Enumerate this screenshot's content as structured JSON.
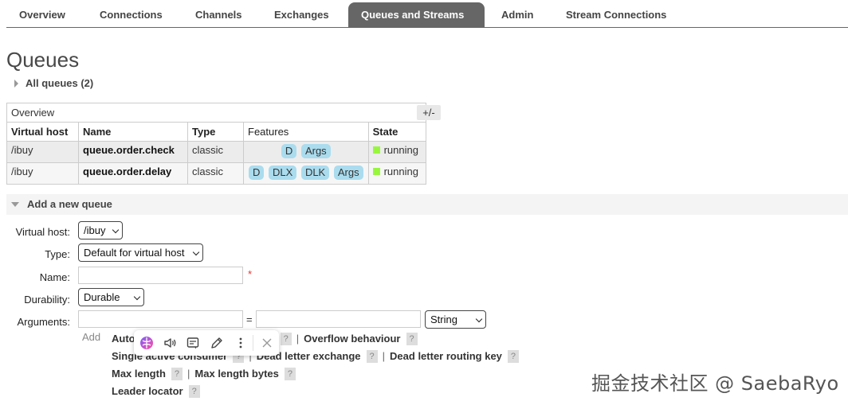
{
  "nav": {
    "tabs": [
      {
        "label": "Overview"
      },
      {
        "label": "Connections"
      },
      {
        "label": "Channels"
      },
      {
        "label": "Exchanges"
      },
      {
        "label": "Queues and Streams",
        "active": true
      },
      {
        "label": "Admin"
      },
      {
        "label": "Stream Connections"
      }
    ]
  },
  "page": {
    "title": "Queues",
    "all_queues": "All queues (2)"
  },
  "table": {
    "group_label": "Overview",
    "toggle_columns": "+/-",
    "headers": {
      "vhost": "Virtual host",
      "name": "Name",
      "type": "Type",
      "features": "Features",
      "state": "State"
    },
    "rows": [
      {
        "vhost": "/ibuy",
        "name": "queue.order.check",
        "type": "classic",
        "features": [
          "D",
          "Args"
        ],
        "state": "running"
      },
      {
        "vhost": "/ibuy",
        "name": "queue.order.delay",
        "type": "classic",
        "features": [
          "D",
          "DLX",
          "DLK",
          "Args"
        ],
        "state": "running"
      }
    ],
    "state_color": "#98f73d",
    "feature_tag_color": "#aadcee"
  },
  "add_queue": {
    "header": "Add a new queue",
    "vhost_label": "Virtual host:",
    "vhost_value": "/ibuy",
    "type_label": "Type:",
    "type_value": "Default for virtual host",
    "name_label": "Name:",
    "name_value": "",
    "required_mark": "*",
    "durability_label": "Durability:",
    "durability_value": "Durable",
    "arguments_label": "Arguments:",
    "arg_key_value": "",
    "equals": "=",
    "arg_value": "",
    "arg_type_value": "String",
    "add_label": "Add",
    "arg_links_row1": {
      "auto_partial": "Auto",
      "overflow": "Overflow behaviour"
    },
    "arg_links_row2": {
      "single_active_partial": "Single active consumer",
      "dlx": "Dead letter exchange",
      "dlk": "Dead letter routing key"
    },
    "arg_links_row3": {
      "max_length": "Max length",
      "max_length_bytes": "Max length bytes"
    },
    "arg_links_row4": {
      "leader_locator": "Leader locator"
    },
    "help_mark": "?",
    "separator": "|"
  },
  "toolbar_icons": [
    "brain-icon",
    "speaker-icon",
    "note-icon",
    "pencil-icon",
    "more-icon",
    "close-icon"
  ],
  "watermark": "掘金技术社区 @ SaebaRyo"
}
